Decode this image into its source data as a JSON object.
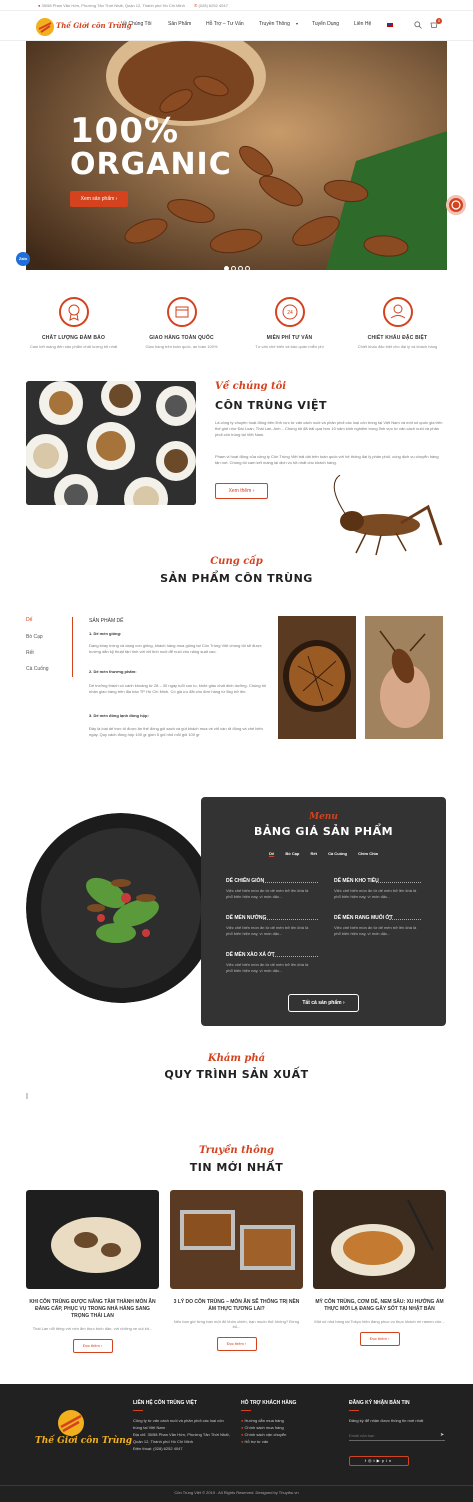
{
  "topbar": {
    "address": "35/58 Phan Văn Hớn, Phường Tân Thới Nhất, Quận 12, Thành phố Hồ Chí Minh",
    "phone": "(028) 6252 4047"
  },
  "header": {
    "logo_text": "Thế Giới côn Trùng",
    "nav": [
      "Về Chúng Tôi",
      "Sản Phẩm",
      "Hỗ Trợ – Tư Vấn",
      "Truyền Thông",
      "Tuyển Dụng",
      "Liên Hệ"
    ],
    "cart_count": "0"
  },
  "hero": {
    "line1": "100%",
    "line2": "ORGANIC",
    "button": "Xem sản phẩm",
    "zalo": "Zalo"
  },
  "features": [
    {
      "title": "CHẤT LƯỢNG ĐẢM BẢO",
      "desc": "Cam kết mang đến sản phẩm chất lượng tốt nhất"
    },
    {
      "title": "GIAO HÀNG TOÀN QUỐC",
      "desc": "Giao hàng trên toàn quốc, an toàn 100%"
    },
    {
      "title": "MIỄN PHÍ TƯ VẤN",
      "desc": "Tư vấn chế biến và bảo quản miễn phí"
    },
    {
      "title": "CHIẾT KHẤU ĐẶC BIỆT",
      "desc": "Chiết khấu đặc biệt cho đại lý và khách hàng"
    }
  ],
  "about": {
    "script": "Về chúng tôi",
    "title": "CÔN TRÙNG VIỆT",
    "p1": "Là công ty chuyên hoạt động trên lĩnh vực tư vấn cách nuôi và phân phối các loại côn trùng tại Việt Nam và một số quốc gia trên thế giới như Đài Loan, Thái Lan, Anh... Chúng tôi đã trải qua hơn 10 năm kinh nghiệm trong lĩnh vực tư vấn cách nuôi và phân phối côn trùng tại Việt Nam.",
    "p2": "Phạm vi hoạt động của công ty Côn Trùng Việt trải dài trên toàn quốc với hệ thống đại lý phân phối, cùng dịch vụ chuyển hàng tận nơi. Chúng tôi cam kết mang lại dịch vụ tốt nhất cho khách hàng.",
    "button": "Xem thêm"
  },
  "products": {
    "script": "Cung cấp",
    "title": "SẢN PHẨM CÔN TRÙNG",
    "tabs": [
      "Dế",
      "Bò Cạp",
      "Rết",
      "Cà Cuống"
    ],
    "heading": "SẢN PHẨM DẾ",
    "s1": "1. Dế mèn giống:",
    "s1t": "Dạng khay trứng và dạng con giống, khách hàng mua giống tại Côn Trùng Việt chúng tôi sẽ được hướng dẫn kỹ thuật tận tình với chỉ tinh nuôi để nuôi cho năng suất cao.",
    "s2": "2. Dế mèn thương phẩm:",
    "s2t": "Dế trưởng thành có cánh khoảng từ 28 – 30 ngày tuổi con to, khỏe giàu chất dinh dưỡng. Chúng tôi nhận giao hàng trên địa bàn TP Hồ Chí Minh. Có giá ưu đãi cho đơn hàng từ 5kg trở lên.",
    "s3": "3. Dế mèn đông lạnh đóng hộp:",
    "s3t": "Đây là loại dế trực tố được ăn thế đóng gói sạch và gút khách mua về chỉ cần rã đông và chế biến ngay. Quy cách đóng hộp 100 gr gồm 5 gói nhỏ mỗi gói 100 gr"
  },
  "menu": {
    "script": "Menu",
    "title": "BẢNG GIÁ SẢN PHẨM",
    "tabs": [
      "Dế",
      "Bò Cạp",
      "Rết",
      "Cà Cuống",
      "Chim Chìa"
    ],
    "items": [
      {
        "name": "DẾ CHIÊN GIÒN",
        "desc": "Việc chế biến món ăn từ dế mèn trở lên khá là phổ biến hiện nay, vì món dặc..."
      },
      {
        "name": "DẾ MÈN KHO TIÊU",
        "desc": "Việc chế biến món ăn từ dế mèn trở lên khá là phổ biến hiện nay, vì món dặc..."
      },
      {
        "name": "DẾ MÈN NƯỚNG",
        "desc": "Việc chế biến món ăn từ dế mèn trở lên khá là phổ biến hiện nay, vì món dặc..."
      },
      {
        "name": "DẾ MÈN RANG MUỐI ỚT",
        "desc": "Việc chế biến món ăn từ dế mèn trở lên khá là phổ biến hiện nay, vì món dặc..."
      },
      {
        "name": "DẾ MÈN XÀO XẢ ỚT",
        "desc": "Việc chế biến món ăn từ dế mèn trở lên khá là phổ biến hiện nay, vì món dặc..."
      }
    ],
    "button": "Tất cả sản phẩm"
  },
  "process": {
    "script": "Khám phá",
    "title": "QUY TRÌNH SẢN XUẤT"
  },
  "news": {
    "script": "Truyền thông",
    "title": "TIN MỚI NHẤT",
    "items": [
      {
        "title": "KHI CÔN TRÙNG ĐƯỢC NÂNG TẦM THÀNH MÓN ĂN ĐẲNG CẤP, PHỤC VỤ TRONG NHÀ HÀNG SANG TRỌNG THÁI LAN",
        "desc": "Thái Lan nổi tiếng với nền ẩm thực bình dân, với những xe cút kít...",
        "button": "Đọc thêm"
      },
      {
        "title": "3 LÝ DO CÔN TRÙNG – MÓN ĂN SẼ THỐNG TRỊ NỀN ẨM THỰC TƯƠNG LAI?",
        "desc": "Nếu bạn giờ từng bạn một đủ khôn chiến, bạn muốn thử không? Đừng bỏ...",
        "button": "Đọc thêm"
      },
      {
        "title": "MỲ CÔN TRÙNG, CƠM DẾ, NEM SÂU: XU HƯỚNG ẨM THỰC MỚI LẠ ĐANG GÂY SỐT TẠI NHẬT BẢN",
        "desc": "Một số nhà hàng tại Tokyo hiện đang phục vụ thực khách mì ramen côn...",
        "button": "Đọc thêm"
      }
    ]
  },
  "footer": {
    "col1_title": "LIÊN HỆ CÔN TRÙNG VIỆT",
    "col1_lines": [
      "Công ty tư vấn cách nuôi và phân phối các loại côn",
      "trùng tại Việt Nam",
      "Địa chỉ: 35/58 Phan Văn Hớn, Phường Tân Thới Nhất,",
      "Quận 12, Thành phố Hồ Chí Minh",
      "Điện thoại: (028) 6252 4047"
    ],
    "col2_title": "HỖ TRỢ KHÁCH HÀNG",
    "col2_links": [
      "Hướng dẫn mua hàng",
      "Chính sách mua hàng",
      "Chính sách vận chuyển",
      "Hỗ trợ tư vấn"
    ],
    "col3_title": "ĐĂNG KÝ NHẬN BẢN TIN",
    "col3_text": "Đăng ký để nhận được thông tin mới nhất",
    "email_placeholder": "Email của bạn",
    "copyright": "Côn Trùng Việt © 2019 . All Rights Reserved. Designed by Thuythu.vn"
  },
  "colors": {
    "accent": "#d4421e",
    "dark": "#212121",
    "card": "#333333"
  }
}
